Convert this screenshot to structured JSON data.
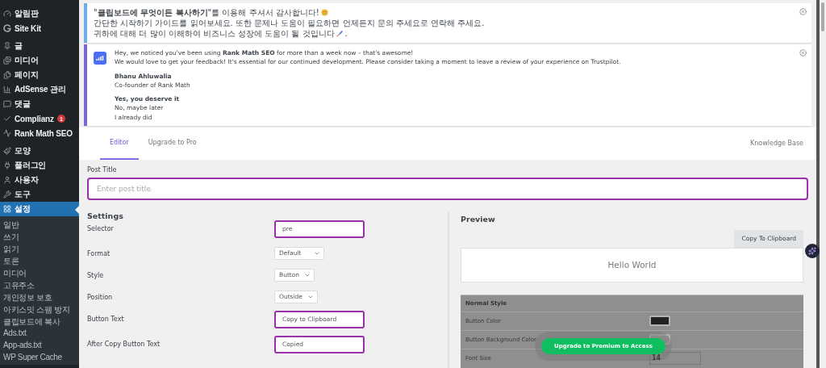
{
  "sidebar": {
    "sections": [
      {
        "items": [
          {
            "label": "알림판",
            "selected": false
          },
          {
            "label": "Site Kit",
            "selected": false
          }
        ]
      },
      {
        "items": [
          {
            "label": "글",
            "selected": false
          },
          {
            "label": "미디어",
            "selected": false
          },
          {
            "label": "페이지",
            "selected": false
          },
          {
            "label": "AdSense 관리",
            "selected": false
          },
          {
            "label": "댓글",
            "selected": false
          },
          {
            "label": "Complianz",
            "selected": false,
            "badge": "1"
          },
          {
            "label": "Rank Math SEO",
            "selected": false
          }
        ]
      },
      {
        "items": [
          {
            "label": "모양",
            "selected": false
          },
          {
            "label": "플러그인",
            "selected": false
          },
          {
            "label": "사용자",
            "selected": false
          },
          {
            "label": "도구",
            "selected": false
          },
          {
            "label": "설정",
            "selected": true,
            "children": [
              {
                "label": "일반",
                "selected": false
              },
              {
                "label": "쓰기",
                "selected": false
              },
              {
                "label": "읽기",
                "selected": false
              },
              {
                "label": "토론",
                "selected": false
              },
              {
                "label": "미디어",
                "selected": false
              },
              {
                "label": "고유주소",
                "selected": false
              },
              {
                "label": "개인정보 보호",
                "selected": false
              },
              {
                "label": "아키스밋 스팸 방지",
                "selected": false
              },
              {
                "label": "클립보드에 복사",
                "selected": false
              },
              {
                "label": "Ads.txt",
                "selected": false
              },
              {
                "label": "App-ads.txt",
                "selected": false
              },
              {
                "label": "WP Super Cache",
                "selected": false
              }
            ]
          }
        ]
      }
    ]
  },
  "notices": [
    {
      "kind": "info",
      "lines": [
        {
          "text": "\"**클립보드에 무엇이든 복사하기**\"를 이용해 주셔서 감사합니다!",
          "emoji": true
        },
        {
          "text": "간단한 시작하기 가이드를 읽어보세요. 또한 문제나 도움이 필요하면 언제든지 문의 주세요로 연락해 주세요.",
          "emoji": false
        },
        {
          "text": "귀하에 대해 더 많이 이해하여 비즈니스 성장에 도움이 될 것입니다",
          "emoji": true,
          "after": "."
        }
      ]
    },
    {
      "kind": "review",
      "lines": [
        {
          "text": "Hey, we noticed you've been using **Rank Math SEO** for more than a week now – that's awesome!"
        },
        {
          "text": "We would love to get your feedback! It's essential for our continued development. Please consider taking a moment to leave a review of your experience on Trustpilot."
        }
      ],
      "author": "Bhanu Ahluwalia",
      "role": "Co-founder of Rank Math",
      "links": [
        {
          "label": "Yes, you deserve it",
          "primary": true
        },
        {
          "label": "No, maybe later",
          "primary": false
        },
        {
          "label": "I already did",
          "primary": false
        }
      ]
    }
  ],
  "tabs": [
    {
      "label": "Editor",
      "selected": true
    },
    {
      "label": "Upgrade to Pro",
      "selected": false
    }
  ],
  "help_link": "Knowledge Base",
  "post_title": {
    "label": "Post Title",
    "placeholder": "Enter post title"
  },
  "settings": {
    "title": "Settings",
    "fields": [
      {
        "kind": "input",
        "label": "Selector",
        "value": "pre"
      },
      {
        "kind": "select",
        "label": "Format",
        "value": "Default"
      },
      {
        "kind": "select",
        "label": "Style",
        "value": "Button"
      },
      {
        "kind": "select",
        "label": "Position",
        "value": "Outside"
      },
      {
        "kind": "input",
        "label": "Button Text",
        "value": "Copy to Clipboard"
      },
      {
        "kind": "input",
        "label": "After Copy Button Text",
        "value": "Copied"
      }
    ]
  },
  "preview": {
    "title": "Preview",
    "copy_button": "Copy To Clipboard",
    "sample": "Hello World",
    "locked": {
      "title": "Normal Style",
      "rows": [
        {
          "kind": "color",
          "label": "Button Color",
          "color": "#222222"
        },
        {
          "kind": "color",
          "label": "Button Background Color",
          "color": "#9a9a9a"
        },
        {
          "kind": "number",
          "label": "Font Size",
          "value": "14"
        }
      ],
      "upgrade_button": "Upgrade to Premium to Access"
    }
  }
}
